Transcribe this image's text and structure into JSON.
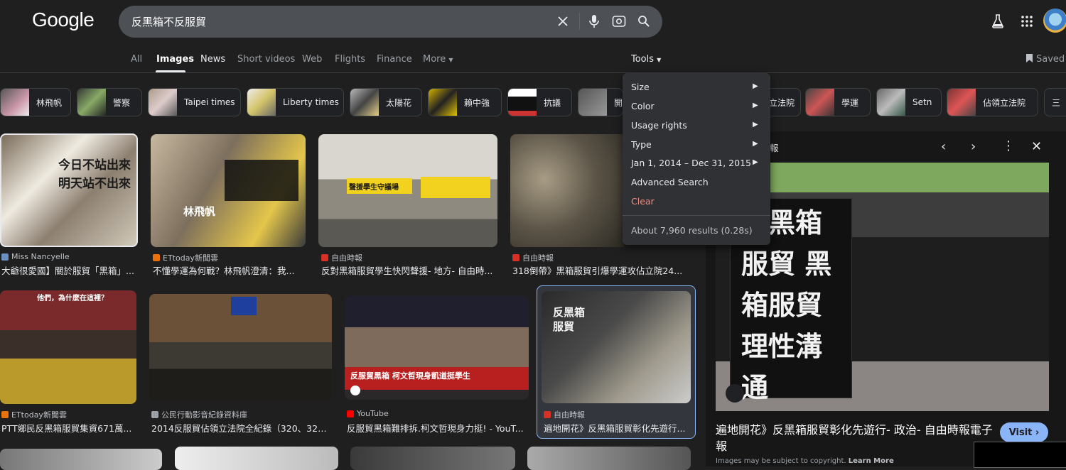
{
  "header": {
    "logo": "Google",
    "query": "反黑箱不反服貿",
    "icons": [
      "clear-icon",
      "mic-icon",
      "lens-icon",
      "search-icon",
      "labs-icon",
      "apps-icon",
      "avatar"
    ]
  },
  "tabs": [
    "All",
    "Images",
    "News",
    "Short videos",
    "Web",
    "Flights",
    "Finance",
    "More"
  ],
  "active_tab": "Images",
  "tools_label": "Tools",
  "saved_label": "Saved",
  "chips": [
    "林飛帆",
    "警察",
    "Taipei times",
    "Liberty times",
    "太陽花",
    "賴中強",
    "抗議",
    "立法院",
    "學運",
    "Setn",
    "佔領立法院",
    "三"
  ],
  "chips_partial_label": "開",
  "tools_menu": {
    "items": [
      "Size",
      "Color",
      "Usage rights",
      "Type",
      "Jan 1, 2014 – Dec 31, 2015",
      "Advanced Search",
      "Clear"
    ],
    "result_stats": "About 7,960 results (0.28s)"
  },
  "results": [
    {
      "source": "Miss Nancyelle",
      "title": "大爺很愛國】關於服貿「黑箱」...",
      "caption": "今日不站出來 明天站不出來"
    },
    {
      "source": "ETtoday新聞雲",
      "title": "不懂學運為何戰？林飛帆澄清：我...",
      "caption": "林飛帆"
    },
    {
      "source": "自由時報",
      "title": "反對黑箱服貿學生快閃聲援- 地方- 自由時...",
      "caption": "聲援學生守議場"
    },
    {
      "source": "自由時報",
      "title": "318倒帶》黑箱服貿引爆學運攻佔立院24...",
      "caption": ""
    },
    {
      "source": "ETtoday新聞雲",
      "title": "PTT鄉民反黑箱服貿集資671萬...",
      "caption": "他們，為什麼在這裡？"
    },
    {
      "source": "公民行動影音紀錄資料庫",
      "title": "2014反服貿佔領立法院全紀錄（320、321...",
      "caption": ""
    },
    {
      "source": "YouTube",
      "title": "反服貿黑箱難排拆.柯文哲現身力挺! - YouT...",
      "caption": "反服貿黑箱 柯文哲現身凱道挺學生"
    },
    {
      "source": "自由時報",
      "title": "遍地開花》反黑箱服貿彰化先遊行...",
      "caption": "反黑箱 服貿"
    }
  ],
  "side_panel": {
    "source_partial": "報",
    "title": "遍地開花》反黑箱服貿彰化先遊行- 政治- 自由時報電子報",
    "visit_label": "Visit",
    "copyright": "Images may be subject to copyright.",
    "learn_more": "Learn More",
    "image_caption": "反黑箱 服貿 黑箱服貿 理性溝通"
  },
  "colors": {
    "background": "#1f1f1f",
    "accent": "#8ab4f8"
  }
}
